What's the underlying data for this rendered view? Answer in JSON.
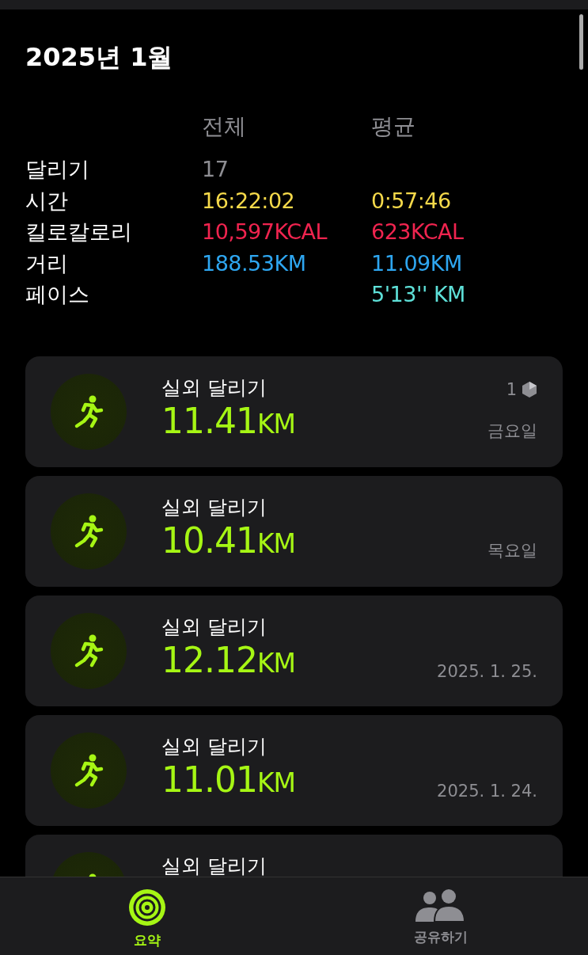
{
  "title": "2025년 1월",
  "stats": {
    "columns": [
      "전체",
      "평균"
    ],
    "rows": [
      {
        "label": "달리기",
        "total": "17",
        "color": "#8e8e93"
      },
      {
        "label": "시간",
        "total": "16:22:02",
        "average": "0:57:46",
        "color": "#f5d94a"
      },
      {
        "label": "킬로칼로리",
        "total": "10,597KCAL",
        "average": "623KCAL",
        "color": "#f0244f"
      },
      {
        "label": "거리",
        "total": "188.53KM",
        "average": "11.09KM",
        "color": "#2ea6f0"
      },
      {
        "label": "페이스",
        "average": "5'13'' KM",
        "color": "#5ee0d8"
      }
    ]
  },
  "workouts": [
    {
      "title": "실외 달리기",
      "distance": "11.41",
      "unit": "KM",
      "badge": "1",
      "date": "금요일"
    },
    {
      "title": "실외 달리기",
      "distance": "10.41",
      "unit": "KM",
      "date": "목요일"
    },
    {
      "title": "실외 달리기",
      "distance": "12.12",
      "unit": "KM",
      "date": "2025. 1. 25."
    },
    {
      "title": "실외 달리기",
      "distance": "11.01",
      "unit": "KM",
      "date": "2025. 1. 24."
    },
    {
      "title": "실외 달리기"
    }
  ],
  "tabs": [
    {
      "label": "요약",
      "kind": "summary",
      "selected": true
    },
    {
      "label": "공유하기",
      "kind": "sharing",
      "selected": false
    }
  ]
}
